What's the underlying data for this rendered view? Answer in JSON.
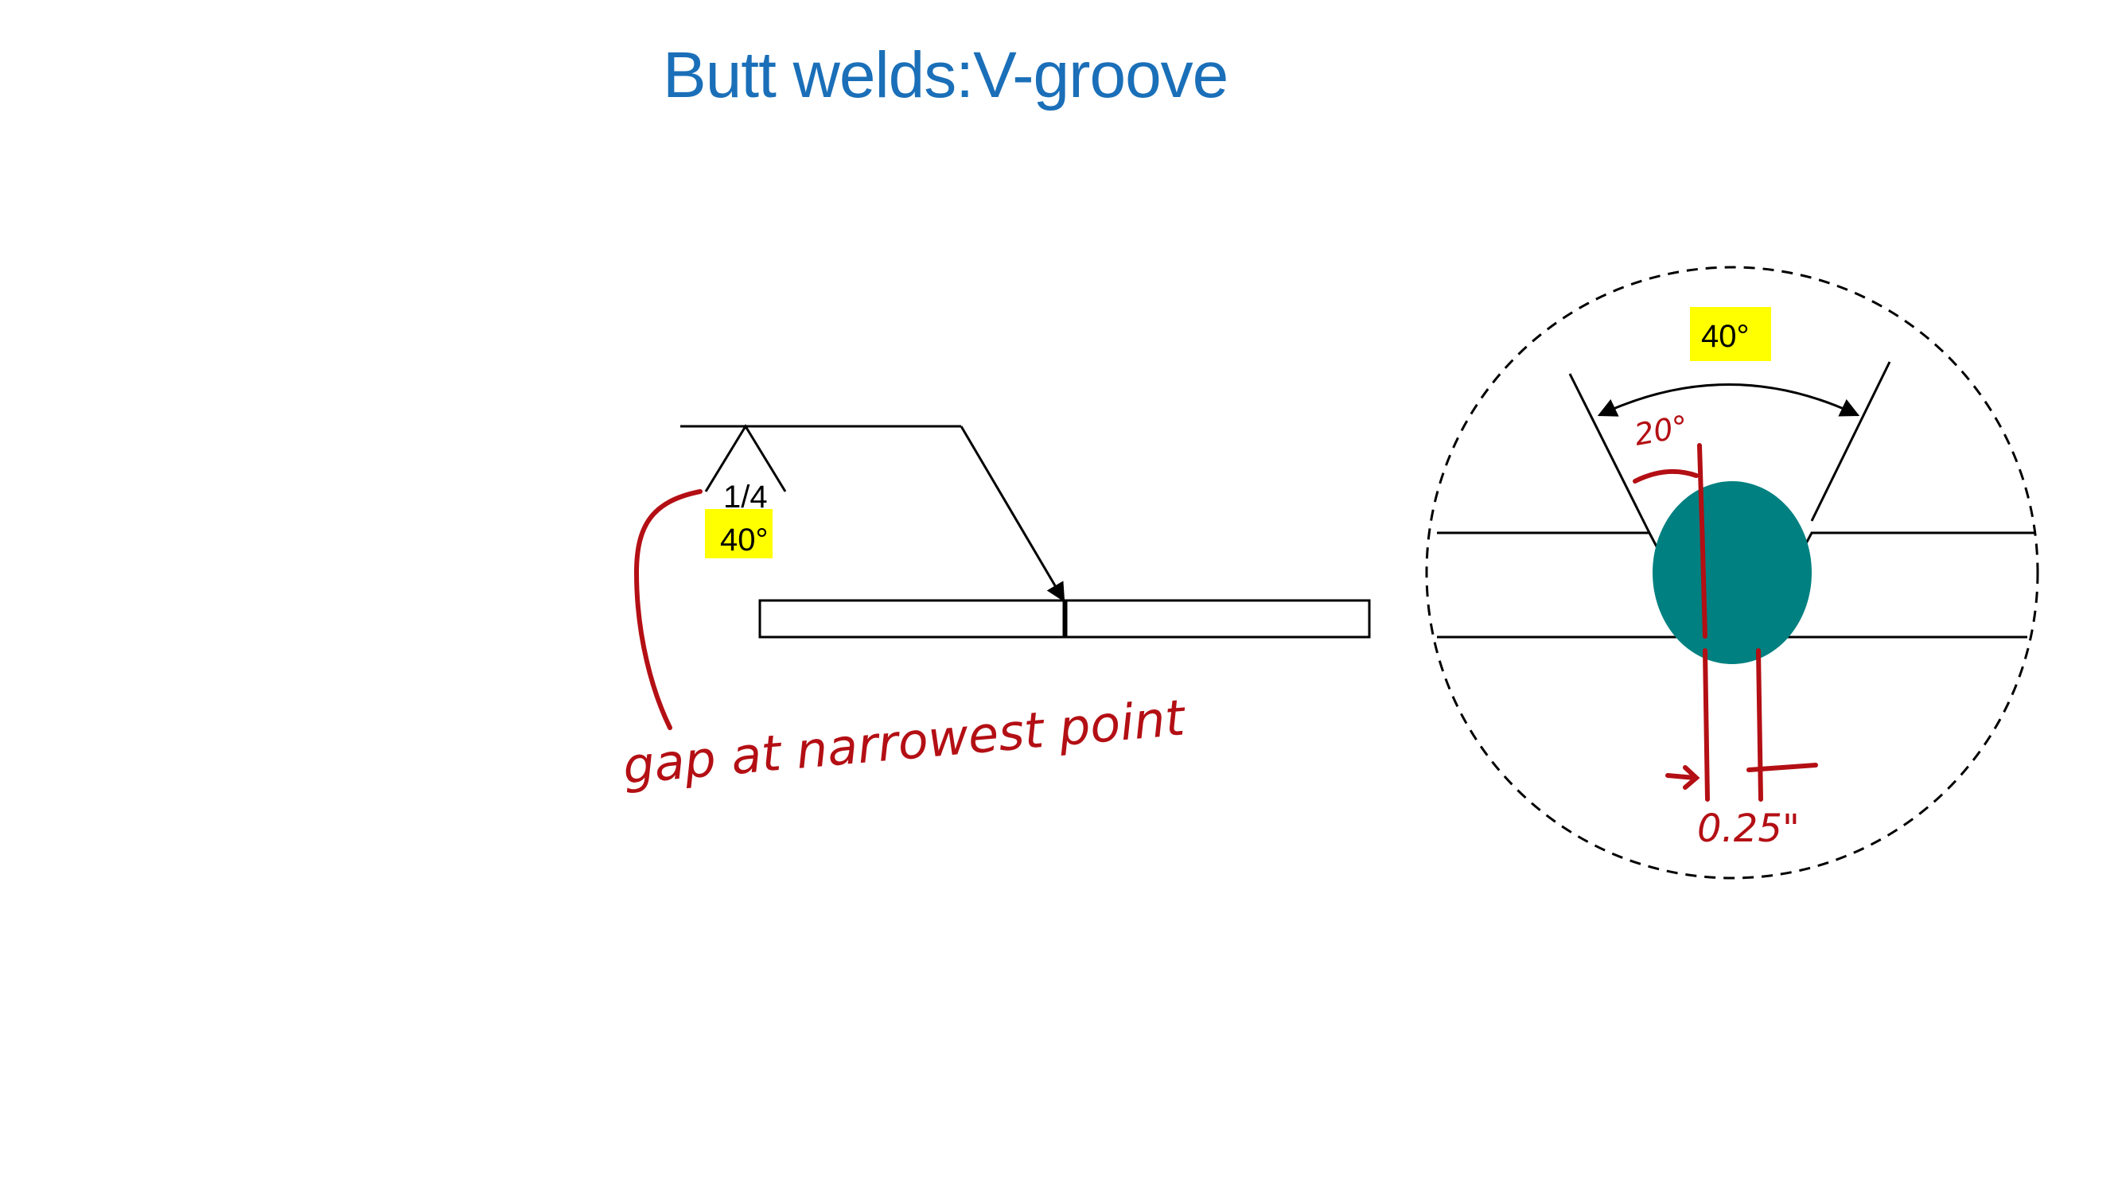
{
  "slide": {
    "title": "Butt welds:V-groove"
  },
  "weld_symbol": {
    "size_label": "1/4",
    "angle_label": "40°",
    "highlight_color": "#ffff00"
  },
  "detail_view": {
    "included_angle_label": "40°",
    "bevel_angle_note": "20°",
    "gap_note": "0.25\"",
    "weld_color": "#008080"
  },
  "annotations": {
    "gap_note": "gap at narrowest point",
    "ink_color": "#b30f14"
  }
}
